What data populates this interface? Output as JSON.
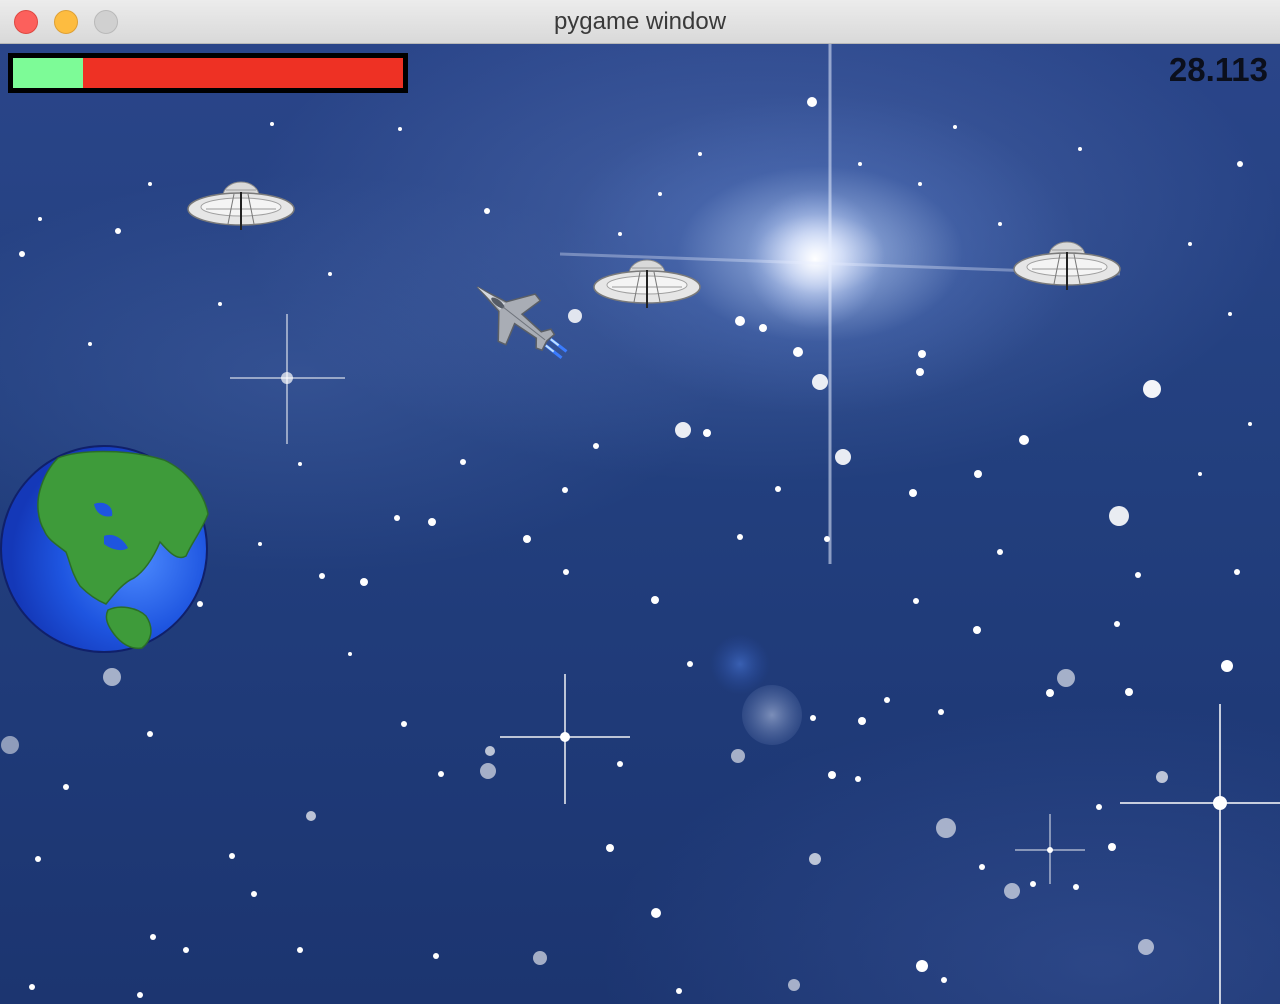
{
  "window": {
    "title": "pygame window"
  },
  "hud": {
    "health_fraction": 0.18,
    "health_color": "#7dfb97",
    "damage_color": "#ee3124",
    "bar_border_color": "#000000",
    "score": "28.113"
  },
  "sprites": {
    "player": "fighter-jet-icon",
    "enemies": [
      "ufo-icon",
      "ufo-icon",
      "ufo-icon"
    ],
    "planet": "earth-icon"
  }
}
